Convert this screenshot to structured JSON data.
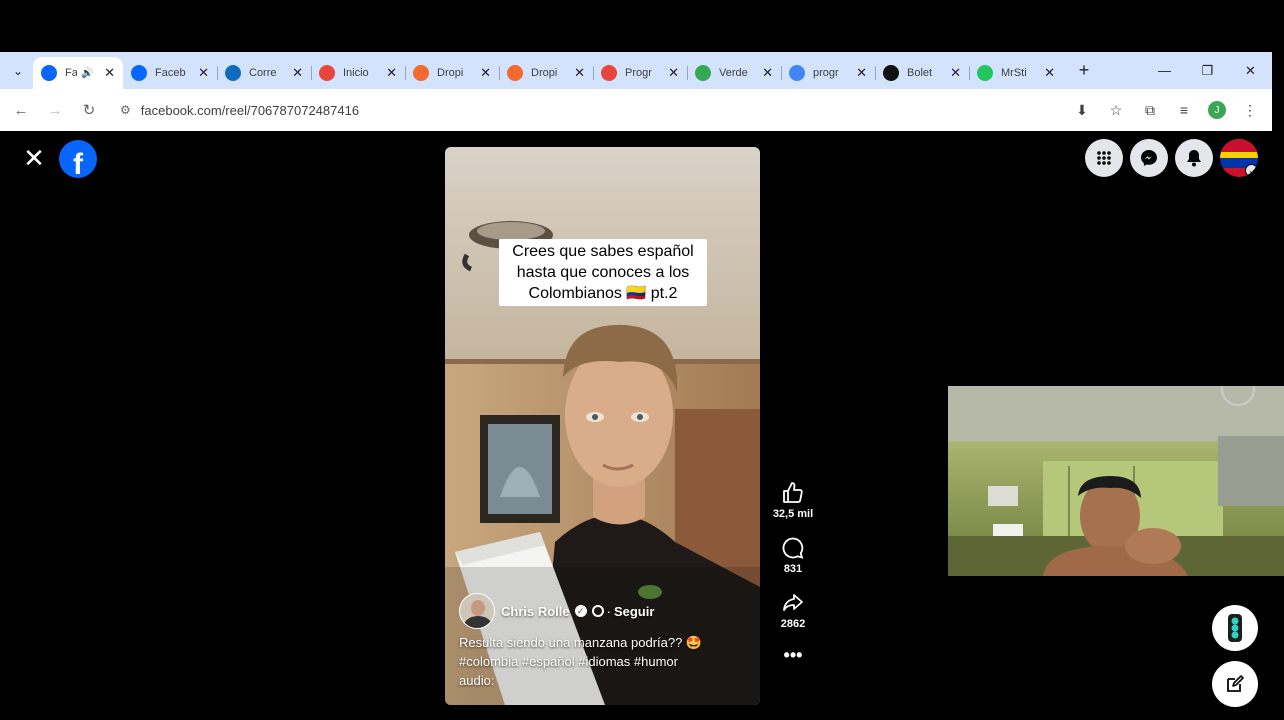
{
  "browser": {
    "tabs": [
      {
        "title": "Fa",
        "favicon": "facebook-icon",
        "color": "#0866ff",
        "active": true,
        "audio": true
      },
      {
        "title": "Faceb",
        "favicon": "facebook-icon",
        "color": "#0866ff"
      },
      {
        "title": "Corre",
        "favicon": "outlook-icon",
        "color": "#0f6cbd"
      },
      {
        "title": "Inicio",
        "favicon": "app-icon",
        "color": "#e8453c"
      },
      {
        "title": "Dropi",
        "favicon": "dropi-icon",
        "color": "#f26a2e"
      },
      {
        "title": "Dropi",
        "favicon": "dropi-icon",
        "color": "#f26a2e"
      },
      {
        "title": "Progr",
        "favicon": "progr-icon",
        "color": "#e8453c"
      },
      {
        "title": "Verde",
        "favicon": "maps-pin-icon",
        "color": "#34a853"
      },
      {
        "title": "progr",
        "favicon": "google-icon",
        "color": "#4285f4"
      },
      {
        "title": "Bolet",
        "favicon": "t-icon",
        "color": "#111111"
      },
      {
        "title": "MrSti",
        "favicon": "k-icon",
        "color": "#22c55e"
      }
    ],
    "url": "facebook.com/reel/706787072487416",
    "profile_initial": "J"
  },
  "reel": {
    "overlay_text": "Crees que sabes español hasta que conoces a los Colombianos 🇨🇴 pt.2",
    "author": "Chris Rolle",
    "follow_label": "Seguir",
    "caption_line1": "Resulta siendo una manzana podría?? 🤩",
    "caption_line2": "#colombia #español #idiomas #humor",
    "caption_line3": "audio:"
  },
  "actions": {
    "likes": "32,5 mil",
    "comments": "831",
    "shares": "2862"
  }
}
